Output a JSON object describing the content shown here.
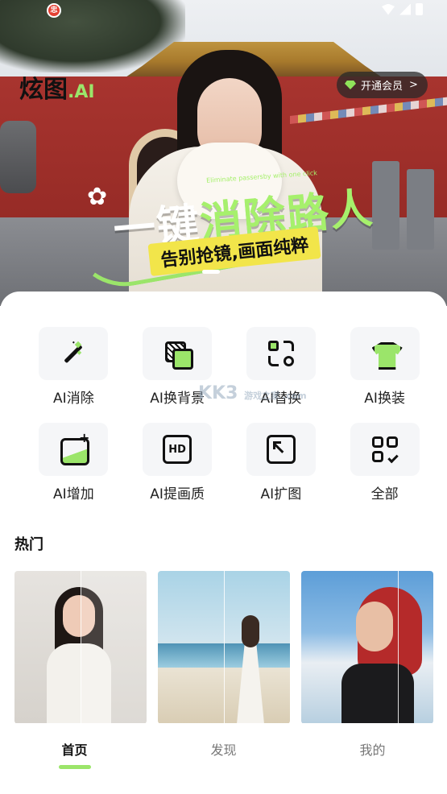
{
  "header": {
    "logo_text": "炫图",
    "logo_suffix": ".AI",
    "vip_button_label": "开通会员",
    "vip_button_chevron": ">"
  },
  "status_bar": {
    "app_badge": "忠"
  },
  "banner": {
    "slogan_part1": "一键",
    "slogan_part2": "消除路人",
    "tagline": "告别抢镜,画面纯粹",
    "small_text": "Eliminate passersby with one click"
  },
  "tools": [
    {
      "label": "AI消除",
      "icon": "magic-wand-icon"
    },
    {
      "label": "AI换背景",
      "icon": "layers-icon"
    },
    {
      "label": "AI替换",
      "icon": "swap-icon"
    },
    {
      "label": "AI换装",
      "icon": "shirt-icon"
    },
    {
      "label": "AI增加",
      "icon": "add-image-icon"
    },
    {
      "label": "AI提画质",
      "icon": "hd-icon"
    },
    {
      "label": "AI扩图",
      "icon": "expand-icon"
    },
    {
      "label": "全部",
      "icon": "grid-icon"
    }
  ],
  "hot": {
    "title": "热门"
  },
  "watermark": {
    "text": "KK3",
    "sub": "游戏之家 .com"
  },
  "tabbar": {
    "items": [
      {
        "label": "首页",
        "active": true
      },
      {
        "label": "发现",
        "active": false
      },
      {
        "label": "我的",
        "active": false
      }
    ]
  },
  "colors": {
    "accent": "#9be56a",
    "tag_yellow": "#f2e54a",
    "text_primary": "#111111",
    "text_secondary": "#777777"
  }
}
